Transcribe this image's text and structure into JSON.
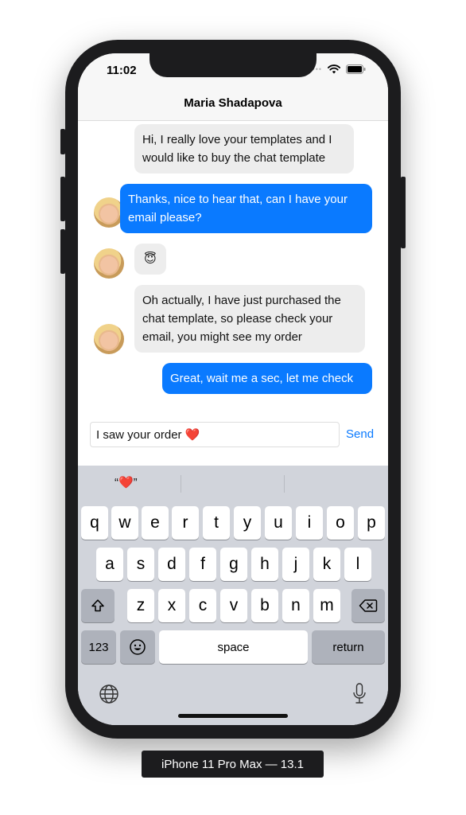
{
  "status": {
    "time": "11:02"
  },
  "chat": {
    "contact_name": "Maria Shadapova",
    "messages": [
      {
        "from": "them",
        "text": "Hi, I really love your templates and I would like to buy the chat template"
      },
      {
        "from": "me",
        "text": "Thanks, nice to hear that, can I have your email please?"
      },
      {
        "from": "them",
        "text": "😇"
      },
      {
        "from": "them",
        "text": "Oh actually, I have just purchased the chat template, so please check your email, you might see my order"
      },
      {
        "from": "me",
        "text": "Great, wait me a sec, let me check"
      }
    ]
  },
  "composer": {
    "value": "I saw your order ❤️",
    "send_label": "Send"
  },
  "keyboard": {
    "prediction": "“❤️”",
    "row1": [
      "q",
      "w",
      "e",
      "r",
      "t",
      "y",
      "u",
      "i",
      "o",
      "p"
    ],
    "row2": [
      "a",
      "s",
      "d",
      "f",
      "g",
      "h",
      "j",
      "k",
      "l"
    ],
    "row3": [
      "z",
      "x",
      "c",
      "v",
      "b",
      "n",
      "m"
    ],
    "shift_icon": "shift-icon",
    "delete_icon": "delete-icon",
    "numbers_label": "123",
    "emoji_icon": "emoji-icon",
    "space_label": "space",
    "return_label": "return",
    "globe_icon": "globe-icon",
    "mic_icon": "microphone-icon"
  },
  "device_label": "iPhone 11 Pro Max — 13.1",
  "colors": {
    "accent": "#0a7aff",
    "incoming_bubble": "#ededed",
    "keyboard_bg": "#d1d4db"
  }
}
